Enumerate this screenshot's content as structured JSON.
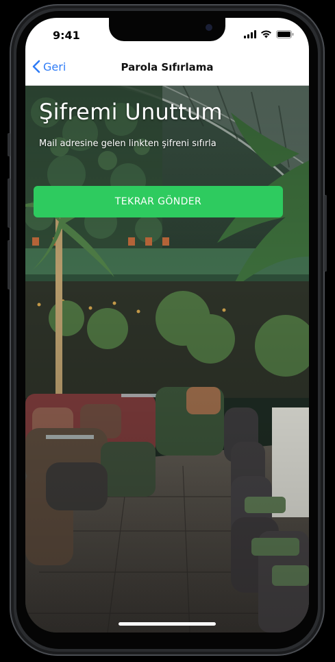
{
  "status_bar": {
    "time": "9:41",
    "signal_icon": "cellular-signal-icon",
    "wifi_icon": "wifi-icon",
    "battery_icon": "battery-icon"
  },
  "nav": {
    "back_icon": "chevron-left-icon",
    "back_label": "Geri",
    "title": "Parola Sıfırlama"
  },
  "main": {
    "heading": "Şifremi Unuttum",
    "subheading": "Mail adresine gelen linkten şifreni sıfırla",
    "resend_button_label": "TEKRAR GÖNDER"
  },
  "colors": {
    "accent_button": "#2ecb5f",
    "link_blue": "#2f7cf6",
    "nav_background": "#ffffff"
  }
}
